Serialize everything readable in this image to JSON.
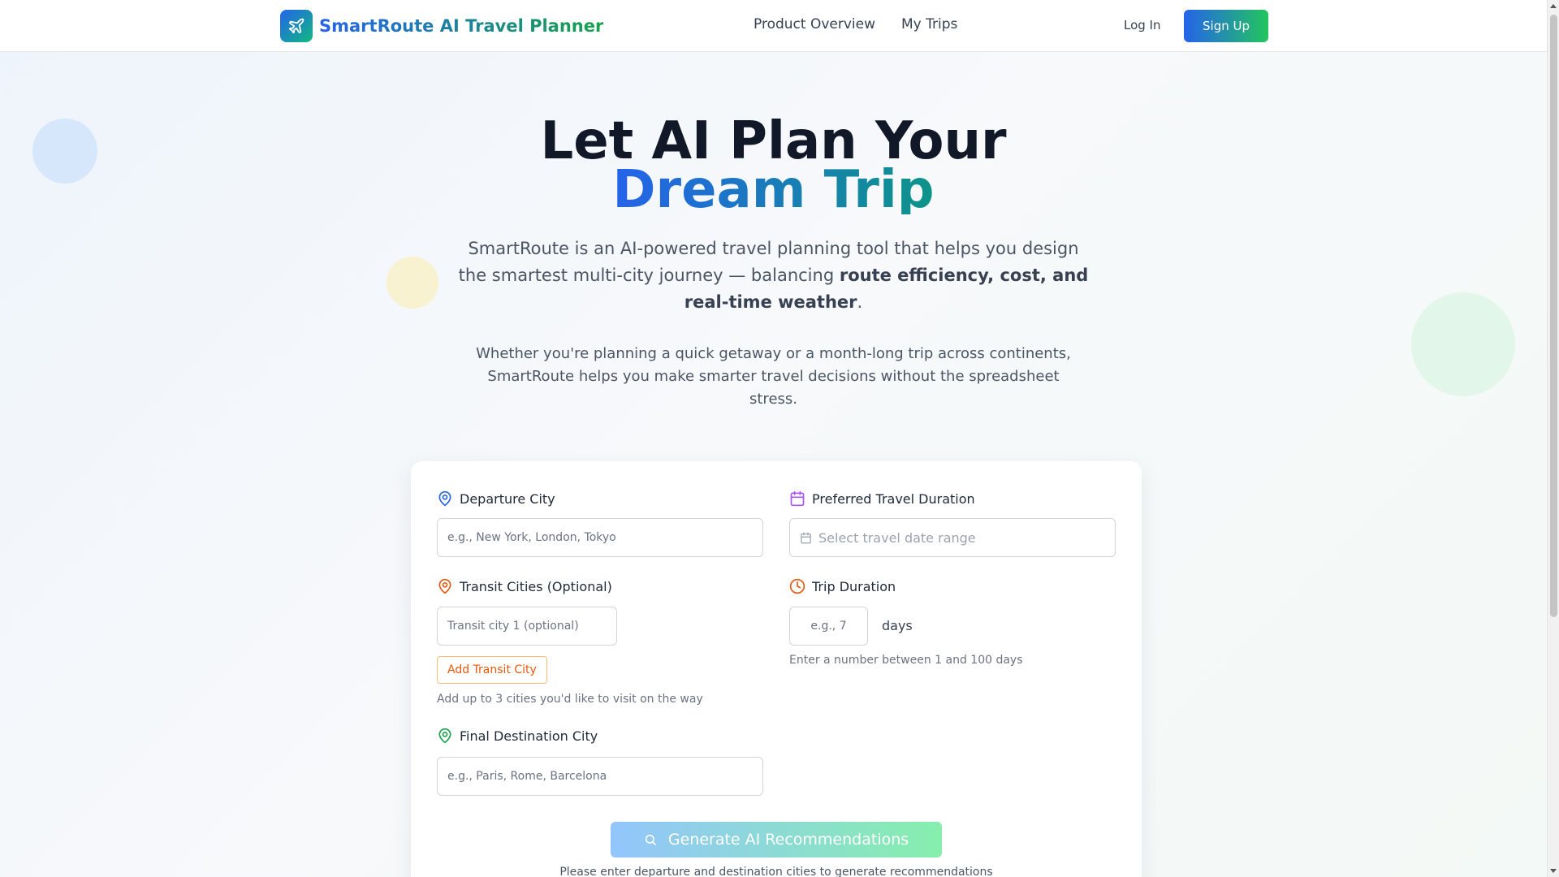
{
  "brand": {
    "name": "SmartRoute AI Travel Planner",
    "logo_icon": "plane-icon"
  },
  "nav": {
    "items": [
      "Product Overview",
      "My Trips"
    ]
  },
  "auth": {
    "login": "Log In",
    "signup": "Sign Up"
  },
  "hero": {
    "title_line1": "Let AI Plan Your",
    "title_line2": "Dream Trip",
    "subtitle_part1": "SmartRoute is an AI-powered travel planning tool that helps you design the smartest multi-city journey — balancing ",
    "subtitle_bold": "route efficiency, cost, and real-time weather",
    "subtitle_part2": ".",
    "description": "Whether you're planning a quick getaway or a month-long trip across continents, SmartRoute helps you make smarter travel decisions without the spreadsheet stress."
  },
  "form": {
    "departure": {
      "label": "Departure City",
      "placeholder": "e.g., New York, London, Tokyo",
      "value": ""
    },
    "travel_duration": {
      "label": "Preferred Travel Duration",
      "placeholder": "Select travel date range"
    },
    "transit": {
      "label": "Transit Cities (Optional)",
      "placeholder": "Transit city 1 (optional)",
      "value": "",
      "add_button": "Add Transit City",
      "hint": "Add up to 3 cities you'd like to visit on the way"
    },
    "trip_duration": {
      "label": "Trip Duration",
      "placeholder": "e.g., 7",
      "value": "",
      "unit": "days",
      "hint": "Enter a number between 1 and 100 days"
    },
    "destination": {
      "label": "Final Destination City",
      "placeholder": "e.g., Paris, Rome, Barcelona",
      "value": ""
    },
    "generate_button": "Generate AI Recommendations",
    "generate_hint": "Please enter departure and destination cities to generate recommendations"
  },
  "colors": {
    "primary_blue": "#2563eb",
    "primary_green": "#22c55e",
    "transit_orange": "#ea580c",
    "calendar_purple": "#a855f7",
    "clock_orange": "#ea580c",
    "destination_green": "#16a34a"
  }
}
